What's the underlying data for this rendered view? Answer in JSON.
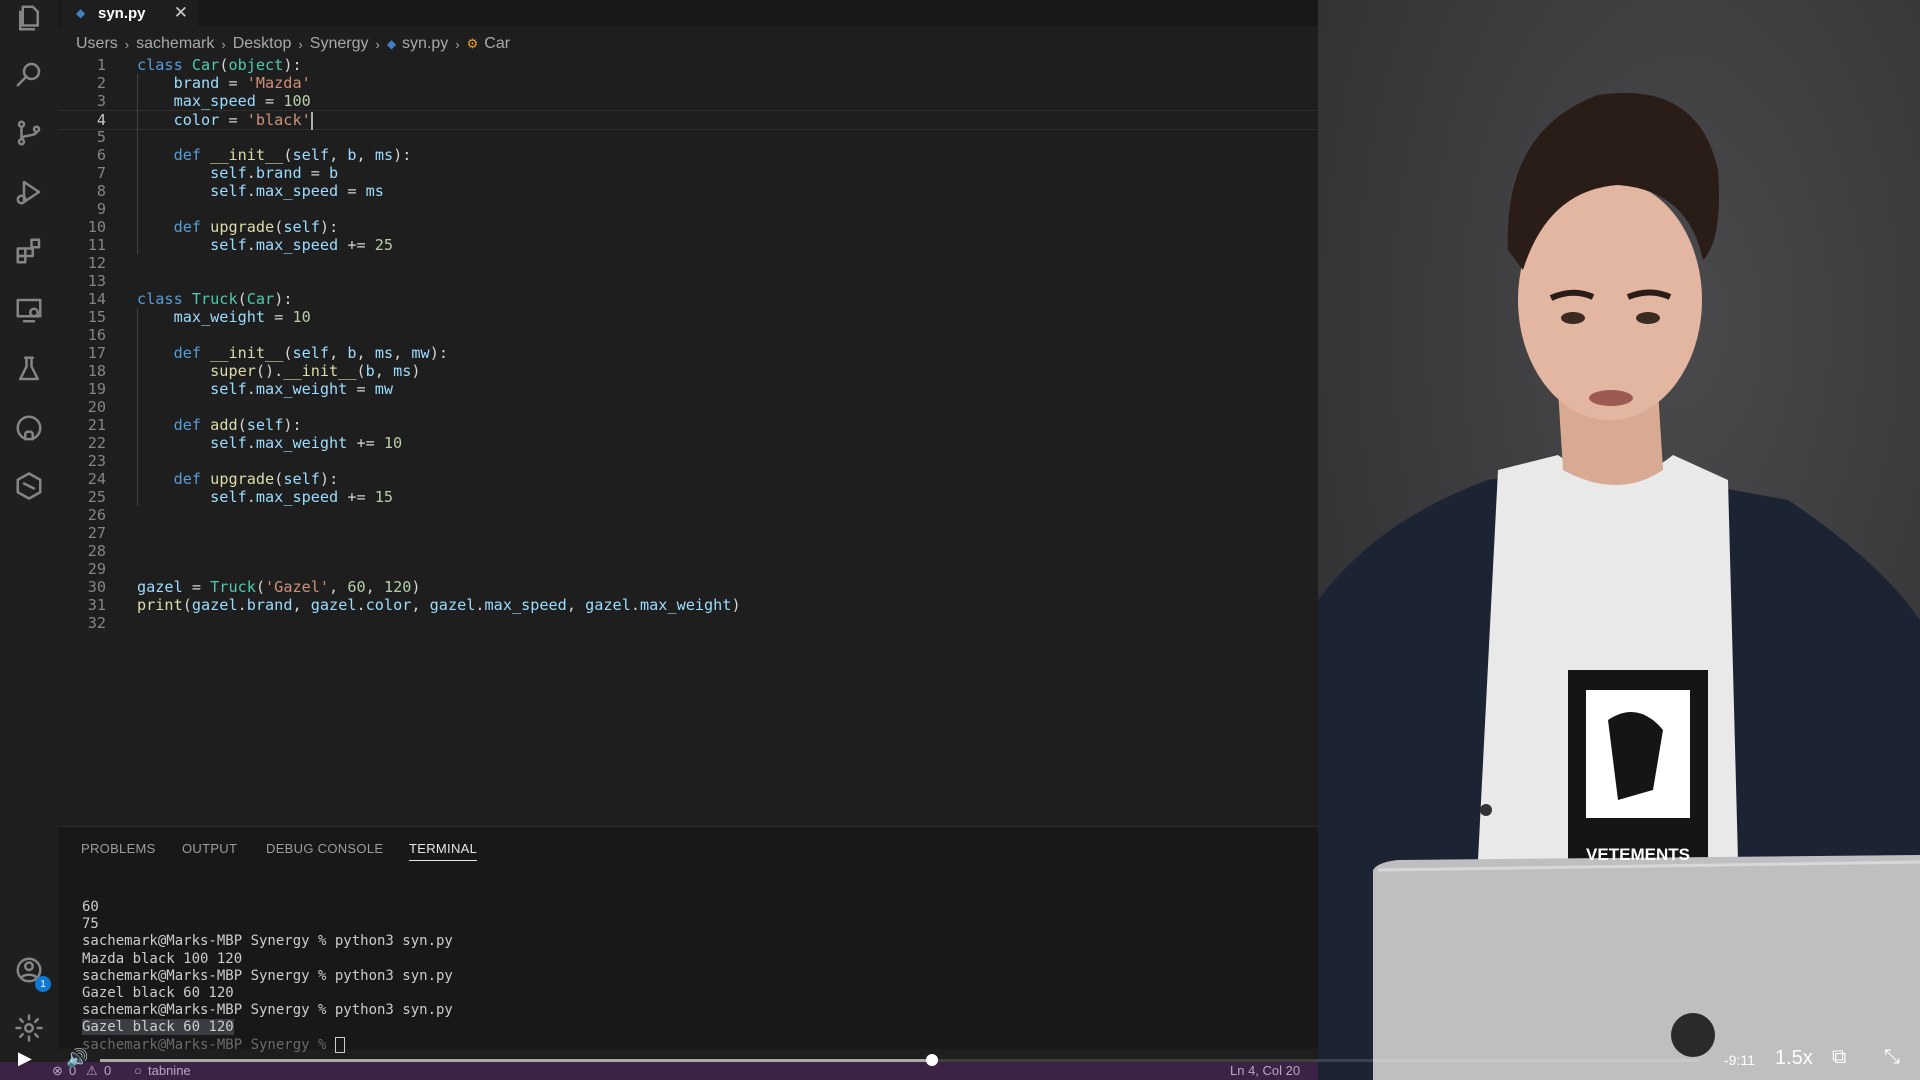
{
  "editor": {
    "tab": {
      "label": "syn.py",
      "close": "✕"
    },
    "breadcrumb": [
      "Users",
      "sachemark",
      "Desktop",
      "Synergy",
      "syn.py",
      "Car"
    ],
    "code_lines": [
      "class Car(object):",
      "    brand = 'Mazda'",
      "    max_speed = 100",
      "    color = 'black'",
      "",
      "    def __init__(self, b, ms):",
      "        self.brand = b",
      "        self.max_speed = ms",
      "",
      "    def upgrade(self):",
      "        self.max_speed += 25",
      "",
      "",
      "class Truck(Car):",
      "    max_weight = 10",
      "",
      "    def __init__(self, b, ms, mw):",
      "        super().__init__(b, ms)",
      "        self.max_weight = mw",
      "",
      "    def add(self):",
      "        self.max_weight += 10",
      "",
      "    def upgrade(self):",
      "        self.max_speed += 15",
      "",
      "",
      "",
      "",
      "gazel = Truck('Gazel', 60, 120)",
      "print(gazel.brand, gazel.color, gazel.max_speed, gazel.max_weight)",
      ""
    ],
    "active_line": 4
  },
  "panel": {
    "tabs": [
      "PROBLEMS",
      "OUTPUT",
      "DEBUG CONSOLE",
      "TERMINAL"
    ],
    "active_tab": "TERMINAL",
    "terminal_lines": [
      "60",
      "75",
      "sachemark@Marks-MBP Synergy % python3 syn.py",
      "Mazda black 100 120",
      "sachemark@Marks-MBP Synergy % python3 syn.py",
      "Gazel black 60 120",
      "sachemark@Marks-MBP Synergy % python3 syn.py",
      "Gazel black 60 120",
      "sachemark@Marks-MBP Synergy % "
    ]
  },
  "statusbar": {
    "errors": "0",
    "warnings": "0",
    "tabnine": "tabnine",
    "position": "Ln 4, Col 20"
  },
  "activity": {
    "icons": [
      "files-icon",
      "search-icon",
      "source-control-icon",
      "run-debug-icon",
      "extensions-icon",
      "remote-explorer-icon",
      "testing-icon",
      "github-icon",
      "deploy-icon"
    ],
    "accounts_badge": "1"
  },
  "video": {
    "time_remaining": "-9:11",
    "speed": "1.5x",
    "progress": 0.52,
    "shirt_text": "VETEMENTS"
  },
  "colors": {
    "editor_bg": "#1e1e1e",
    "statusbar_bg": "#3a2344",
    "keyword": "#569cd6",
    "class": "#4ec9b0",
    "string": "#ce9178",
    "number": "#b5cea8"
  }
}
